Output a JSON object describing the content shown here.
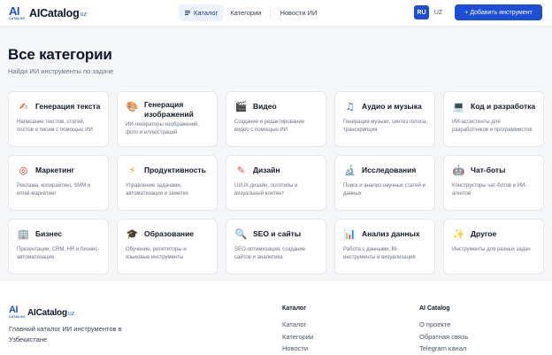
{
  "header": {
    "logo": {
      "mark": "AI",
      "mark_sub": "CATALOG",
      "name": "AICatalog",
      "tld": "uz"
    },
    "nav": [
      {
        "label": "Каталог",
        "active": true
      },
      {
        "label": "Категории",
        "active": false
      },
      {
        "label": "Новости ИИ",
        "active": false
      }
    ],
    "languages": [
      "RU",
      "UZ"
    ],
    "active_language": "RU",
    "add_button_label": "+ Добавить инструмент"
  },
  "main": {
    "title": "Все категории",
    "subtitle": "Найди ИИ инструменты по задаче",
    "categories": [
      {
        "icon": "writing-hand-icon",
        "glyph": "✍",
        "title": "Генерация текста",
        "desc": "Написание текстов, статей, постов и писем с помощью ИИ"
      },
      {
        "icon": "palette-icon",
        "glyph": "🎨",
        "title": "Генерация изображений",
        "desc": "ИИ-генераторы изображений, фото и иллюстраций"
      },
      {
        "icon": "film-icon",
        "glyph": "🎬",
        "title": "Видео",
        "desc": "Создание и редактирование видео с помощью ИИ"
      },
      {
        "icon": "music-note-icon",
        "glyph": "♫",
        "title": "Аудио и музыка",
        "desc": "Генерация музыки, синтез голоса, транскрипция"
      },
      {
        "icon": "laptop-icon",
        "glyph": "💻",
        "title": "Код и разработка",
        "desc": "ИИ-ассистенты для разработчиков и программистов"
      },
      {
        "icon": "target-icon",
        "glyph": "◎",
        "title": "Маркетинг",
        "desc": "Реклама, копирайтинг, SMM и email-маркетинг"
      },
      {
        "icon": "lightning-icon",
        "glyph": "⚡",
        "title": "Продуктивность",
        "desc": "Управление задачами, автоматизация и заметки"
      },
      {
        "icon": "pencil-icon",
        "glyph": "✎",
        "title": "Дизайн",
        "desc": "UI/UX дизайн, логотипы и визуальный контент"
      },
      {
        "icon": "microscope-icon",
        "glyph": "🔬",
        "title": "Исследования",
        "desc": "Поиск и анализ научных статей и данных"
      },
      {
        "icon": "robot-icon",
        "glyph": "🤖",
        "title": "Чат-боты",
        "desc": "Конструкторы чат-ботов и ИИ-агентов"
      },
      {
        "icon": "office-building-icon",
        "glyph": "🏢",
        "title": "Бизнес",
        "desc": "Презентации, CRM, HR и бизнес-автоматизация"
      },
      {
        "icon": "graduation-cap-icon",
        "glyph": "🎓",
        "title": "Образование",
        "desc": "Обучение, репетиторы и языковые инструменты"
      },
      {
        "icon": "magnifier-icon",
        "glyph": "🔍",
        "title": "SEO и сайты",
        "desc": "SEO-оптимизация, создание сайтов и аналитика"
      },
      {
        "icon": "bar-chart-icon",
        "glyph": "📊",
        "title": "Анализ данных",
        "desc": "Работа с данными, BI-инструменты и визуализация"
      },
      {
        "icon": "sparkles-icon",
        "glyph": "✨",
        "title": "Другое",
        "desc": "Инструменты для разных задач"
      }
    ]
  },
  "footer": {
    "about": "Главный каталог ИИ инструментов в Узбекистане",
    "columns": [
      {
        "title": "Каталог",
        "links": [
          "Каталог",
          "Категории",
          "Новости"
        ]
      },
      {
        "title": "AI Catalog",
        "links": [
          "О проекте",
          "Обратная связь",
          "Telegram канал"
        ]
      }
    ]
  },
  "colors": {
    "accent": "#1d4ed8",
    "background": "#f5f6f8",
    "card": "#ffffff"
  }
}
